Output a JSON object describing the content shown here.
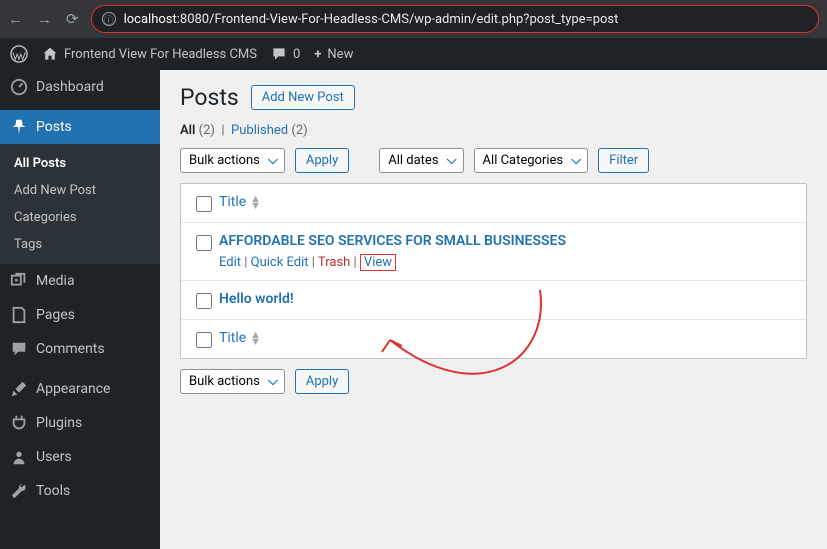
{
  "browser": {
    "url_prefix": "localhost",
    "url_rest": ":8080/Frontend-View-For-Headless-CMS/wp-admin/edit.php?post_type=post"
  },
  "adminbar": {
    "site_name": "Frontend View For Headless CMS",
    "comments": "0",
    "new": "New"
  },
  "sidebar": {
    "dashboard": "Dashboard",
    "posts": "Posts",
    "posts_sub": {
      "all": "All Posts",
      "add": "Add New Post",
      "cats": "Categories",
      "tags": "Tags"
    },
    "media": "Media",
    "pages": "Pages",
    "comments": "Comments",
    "appearance": "Appearance",
    "plugins": "Plugins",
    "users": "Users",
    "tools": "Tools"
  },
  "page": {
    "title": "Posts",
    "add_new": "Add New Post",
    "filter_all": "All",
    "filter_all_count": "(2)",
    "filter_published": "Published",
    "filter_published_count": "(2)",
    "bulk": "Bulk actions",
    "apply": "Apply",
    "dates": "All dates",
    "cats": "All Categories",
    "filter": "Filter",
    "col_title": "Title",
    "rows": [
      {
        "title": "AFFORDABLE SEO SERVICES FOR SMALL BUSINESSES",
        "edit": "Edit",
        "quick": "Quick Edit",
        "trash": "Trash",
        "view": "View"
      },
      {
        "title": "Hello world!"
      }
    ]
  }
}
